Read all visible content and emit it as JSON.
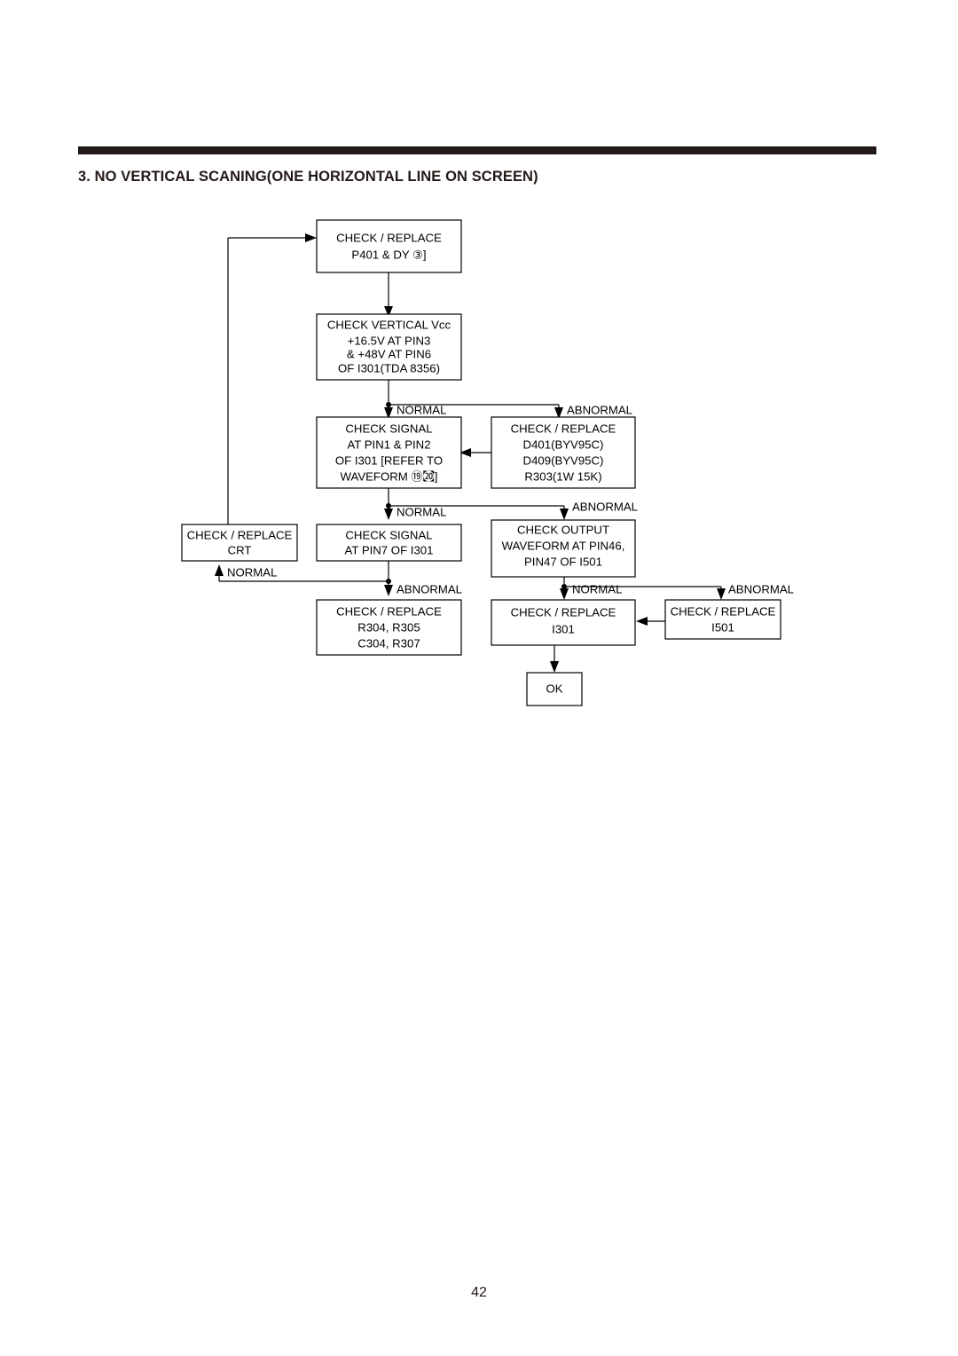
{
  "document": {
    "section_title": "3. NO VERTICAL SCANING(ONE HORIZONTAL LINE ON SCREEN)",
    "page_number": "42",
    "rule_color": "#231916",
    "text_color": "#000000",
    "background_color": "#ffffff"
  },
  "flowchart": {
    "type": "troubleshooting-flowchart",
    "nodes": [
      {
        "id": "n1",
        "name": "check-replace-p401-dy",
        "lines": [
          "CHECK / REPLACE",
          "P401 & DY ③]"
        ]
      },
      {
        "id": "n2",
        "name": "check-vertical-vcc",
        "lines": [
          "CHECK VERTICAL Vcc",
          "+16.5V AT PIN3",
          "& +48V AT PIN6",
          "OF I301(TDA 8356)"
        ]
      },
      {
        "id": "n3",
        "name": "check-signal-pin1-pin2",
        "lines": [
          "CHECK SIGNAL",
          "AT PIN1 & PIN2",
          "OF I301 [REFER TO",
          "WAVEFORM ⑲㉉]"
        ]
      },
      {
        "id": "n4",
        "name": "check-replace-d401-d409-r303",
        "lines": [
          "CHECK / REPLACE",
          "D401(BYV95C)",
          "D409(BYV95C)",
          "R303(1W 15K)"
        ]
      },
      {
        "id": "n5",
        "name": "check-replace-crt",
        "lines": [
          "CHECK / REPLACE",
          "CRT"
        ]
      },
      {
        "id": "n6",
        "name": "check-signal-pin7",
        "lines": [
          "CHECK SIGNAL",
          "AT PIN7 OF I301"
        ]
      },
      {
        "id": "n7",
        "name": "check-output-waveform-i501",
        "lines": [
          "CHECK OUTPUT",
          "WAVEFORM AT PIN46,",
          "PIN47 OF I501"
        ]
      },
      {
        "id": "n8",
        "name": "check-replace-r304-r305-c304-r307",
        "lines": [
          "CHECK / REPLACE",
          "R304, R305",
          "C304, R307"
        ]
      },
      {
        "id": "n9",
        "name": "check-replace-i301",
        "lines": [
          "CHECK / REPLACE",
          "I301"
        ]
      },
      {
        "id": "n10",
        "name": "check-replace-i501",
        "lines": [
          "CHECK / REPLACE",
          "I501"
        ]
      },
      {
        "id": "n11",
        "name": "ok-terminal",
        "lines": [
          "OK"
        ]
      }
    ],
    "edge_labels": [
      {
        "id": "l1",
        "name": "edge-label-normal-vcc",
        "text": "NORMAL"
      },
      {
        "id": "l2",
        "name": "edge-label-abnormal-vcc",
        "text": "ABNORMAL"
      },
      {
        "id": "l3",
        "name": "edge-label-normal-signal12",
        "text": "NORMAL"
      },
      {
        "id": "l4",
        "name": "edge-label-abnormal-signal12",
        "text": "ABNORMAL"
      },
      {
        "id": "l5",
        "name": "edge-label-normal-crt",
        "text": "NORMAL"
      },
      {
        "id": "l6",
        "name": "edge-label-abnormal-pin7",
        "text": "ABNORMAL"
      },
      {
        "id": "l7",
        "name": "edge-label-normal-output",
        "text": "NORMAL"
      },
      {
        "id": "l8",
        "name": "edge-label-abnormal-output",
        "text": "ABNORMAL"
      }
    ]
  }
}
